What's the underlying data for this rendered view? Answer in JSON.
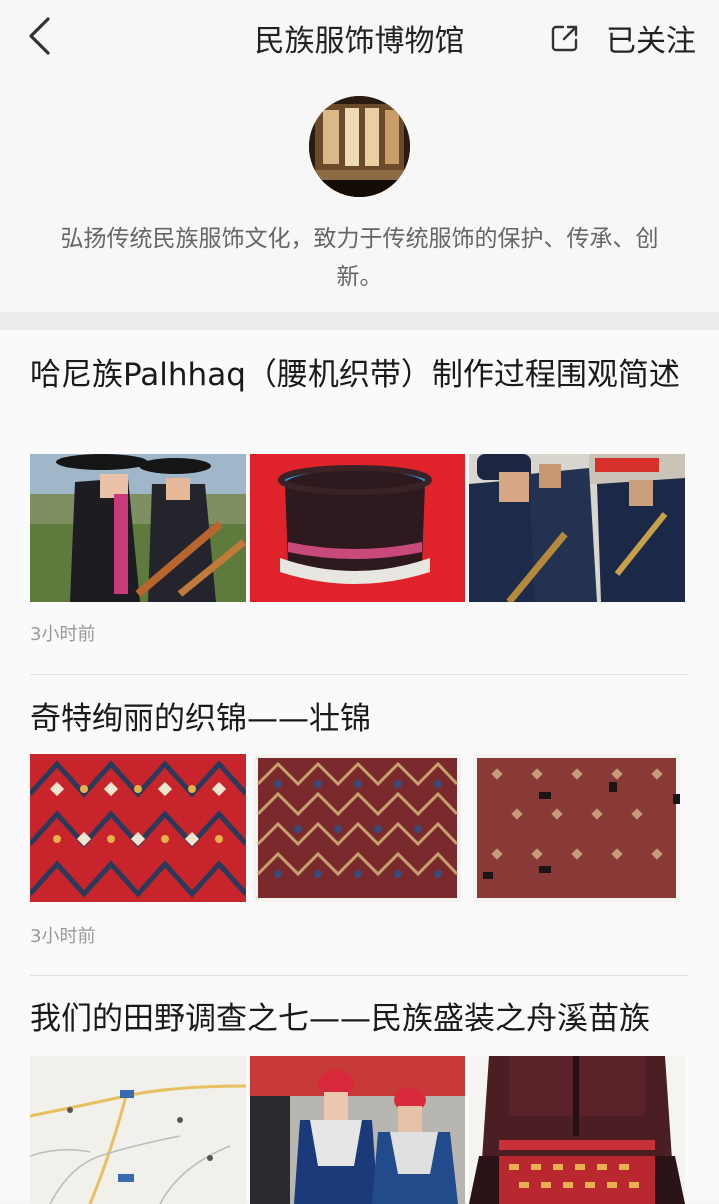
{
  "header": {
    "title": "民族服饰博物馆",
    "follow_label": "已关注"
  },
  "profile": {
    "description": "弘扬传统民族服饰文化，致力于传统服饰的保护、传承、创新。"
  },
  "articles": [
    {
      "title": "哈尼族Palhhaq（腰机织带）制作过程围观简述",
      "time": "3小时前",
      "thumbs": [
        "people-in-costume-photo",
        "hat-photo",
        "musicians-photo"
      ]
    },
    {
      "title": "奇特绚丽的织锦——壮锦",
      "time": "3小时前",
      "thumbs": [
        "brocade-photo",
        "brocade-photo",
        "brocade-photo"
      ]
    },
    {
      "title": "我们的田野调查之七——民族盛装之舟溪苗族",
      "thumbs": [
        "map-photo",
        "performers-photo",
        "costume-photo"
      ]
    }
  ],
  "colors": {
    "background": "#f5f5f5",
    "feed_background": "#fafafa",
    "meta_text": "#999999",
    "description_text": "#666666"
  }
}
